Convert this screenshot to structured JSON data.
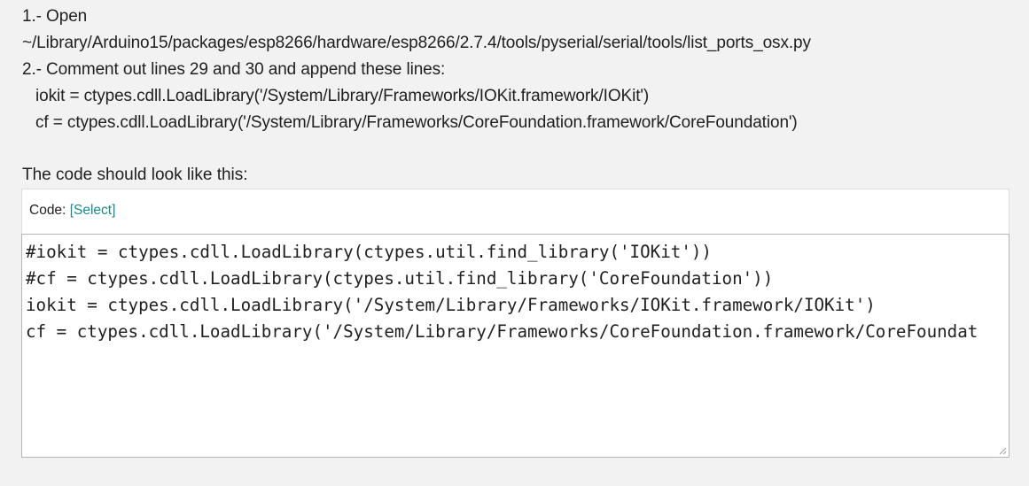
{
  "instructions": {
    "step1_label": "1.- Open",
    "step1_path": "~/Library/Arduino15/packages/esp8266/hardware/esp8266/2.7.4/tools/pyserial/serial/tools/list_ports_osx.py",
    "step2_label": "2.- Comment out lines 29 and 30 and append these lines:",
    "append_line_1": "iokit = ctypes.cdll.LoadLibrary('/System/Library/Frameworks/IOKit.framework/IOKit')",
    "append_line_2": "cf = ctypes.cdll.LoadLibrary('/System/Library/Frameworks/CoreFoundation.framework/CoreFoundation')"
  },
  "intro_text": "The code should look like this:",
  "code_block": {
    "label": "Code:",
    "select_link": "[Select]",
    "lines": [
      "#iokit = ctypes.cdll.LoadLibrary(ctypes.util.find_library('IOKit'))",
      "#cf = ctypes.cdll.LoadLibrary(ctypes.util.find_library('CoreFoundation'))",
      "iokit = ctypes.cdll.LoadLibrary('/System/Library/Frameworks/IOKit.framework/IOKit')",
      "cf = ctypes.cdll.LoadLibrary('/System/Library/Frameworks/CoreFoundation.framework/CoreFoundat"
    ]
  },
  "colors": {
    "background": "#f2f2f2",
    "link": "#1a8a8a",
    "text": "#1f1f1f"
  }
}
